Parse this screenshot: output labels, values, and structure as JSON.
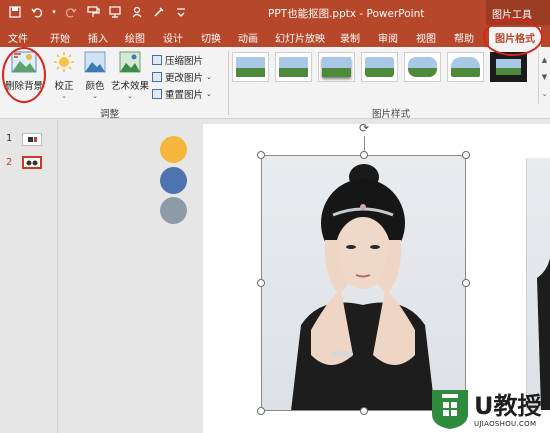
{
  "window": {
    "title": "PPT也能抠图.pptx  -  PowerPoint",
    "context_tab_group": "图片工具"
  },
  "quick_access": {
    "save": "💾",
    "undo": "↶",
    "redo": "↷",
    "icons": [
      "save-icon",
      "undo-icon",
      "redo-icon",
      "format-painter-icon",
      "presenter-icon",
      "color-picker-icon",
      "touch-mode-icon",
      "customize-icon"
    ]
  },
  "tabs": [
    {
      "label": "文件"
    },
    {
      "label": "开始"
    },
    {
      "label": "插入"
    },
    {
      "label": "绘图"
    },
    {
      "label": "设计"
    },
    {
      "label": "切换"
    },
    {
      "label": "动画"
    },
    {
      "label": "幻灯片放映"
    },
    {
      "label": "录制"
    },
    {
      "label": "审阅"
    },
    {
      "label": "视图"
    },
    {
      "label": "帮助"
    },
    {
      "label": "图片格式"
    }
  ],
  "ribbon": {
    "remove_background": "删除背景",
    "corrections": "校正",
    "color": "颜色",
    "artistic_effects": "艺术效果",
    "compress": "压缩图片",
    "change_picture": "更改图片",
    "reset_picture": "重置图片",
    "group_adjust": "调整",
    "group_picture_styles": "图片样式"
  },
  "slides": [
    {
      "number": "1"
    },
    {
      "number": "2"
    }
  ],
  "colors": {
    "accent": "#b7472a",
    "circle_1": "#f4b73b",
    "circle_2": "#4c72b0",
    "circle_3": "#8e9aa6",
    "annotation": "#d9241b"
  },
  "watermark": {
    "brand": "U教授",
    "url": "UJIAOSHOU.COM"
  }
}
